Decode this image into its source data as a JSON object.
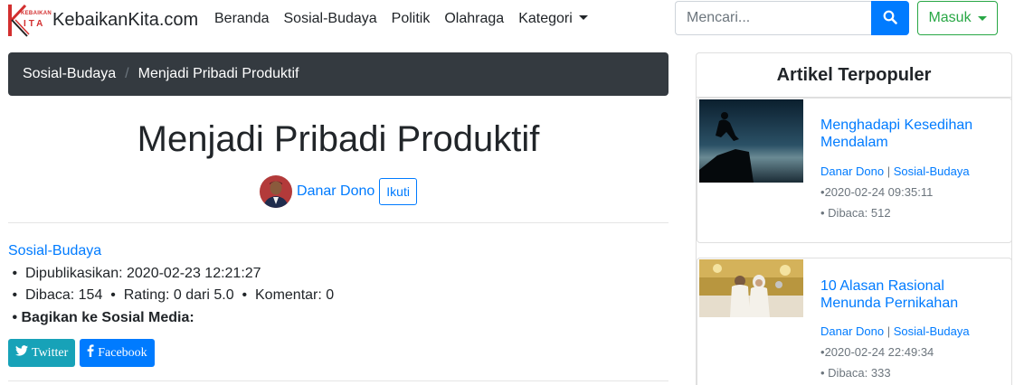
{
  "brand": {
    "name": "KebaikanKita.com",
    "logo_text_top": "KEBAIKAN",
    "logo_text_bottom": "ITA"
  },
  "nav": {
    "items": [
      "Beranda",
      "Sosial-Budaya",
      "Politik",
      "Olahraga",
      "Kategori"
    ]
  },
  "search": {
    "placeholder": "Mencari...",
    "value": ""
  },
  "login": {
    "label": "Masuk"
  },
  "breadcrumb": {
    "category": "Sosial-Budaya",
    "current": "Menjadi Pribadi Produktif"
  },
  "article": {
    "title": "Menjadi Pribadi Produktif",
    "author": "Danar Dono",
    "follow_label": "Ikuti",
    "category": "Sosial-Budaya",
    "published_label": "Dipublikasikan:",
    "published": "2020-02-23 12:21:27",
    "read_label": "Dibaca:",
    "reads": "154",
    "rating_label": "Rating:",
    "rating": "0 dari 5.0",
    "comments_label": "Komentar:",
    "comments": "0",
    "share_label": "Bagikan ke Sosial Media:",
    "twitter_label": "Twitter",
    "facebook_label": "Facebook"
  },
  "sidebar": {
    "title": "Artikel Terpopuler",
    "items": [
      {
        "title": "Menghadapi Kesedihan Mendalam",
        "author": "Danar Dono",
        "category": "Sosial-Budaya",
        "date": "2020-02-24 09:35:11",
        "read_label": "Dibaca:",
        "reads": "512"
      },
      {
        "title": "10 Alasan Rasional Menunda Pernikahan",
        "author": "Danar Dono",
        "category": "Sosial-Budaya",
        "date": "2020-02-24 22:49:34",
        "read_label": "Dibaca:",
        "reads": "333"
      }
    ]
  },
  "colors": {
    "primary": "#007bff",
    "success": "#28a745",
    "dark": "#343a40",
    "info": "#17a2b8",
    "logo_red": "#d32f2f"
  }
}
